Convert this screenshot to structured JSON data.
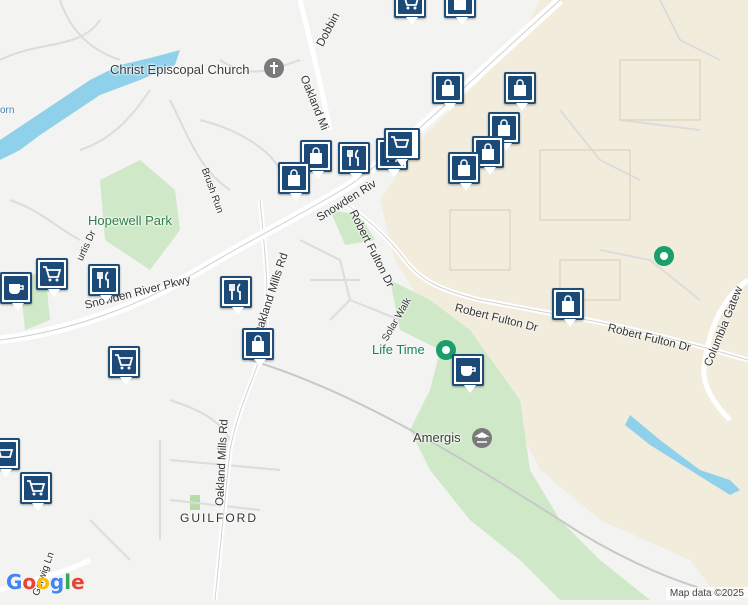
{
  "map": {
    "roads": [
      "Snowden River Pkwy",
      "Robert Fulton Dr",
      "Robert Fulton Dr",
      "Robert Fulton Dr",
      "Oakland Mills Rd",
      "Oakland Mills Rd",
      "Oakland Mi",
      "Snowden Riv",
      "Columbia Gatew",
      "Solar Walk",
      "Brush Run",
      "Dobbin",
      "Gerwig Ln",
      "urtis Dr"
    ],
    "pois": {
      "church": "Christ Episcopal Church",
      "park": "Hopewell Park",
      "gym": "Life Time",
      "office": "Amergis"
    },
    "place": "GUILFORD",
    "water_label": "orn",
    "colors": {
      "background": "#f3f3f1",
      "water": "#8fd1ea",
      "park": "#cfe9c8",
      "commercial": "#f2ecdd",
      "road": "#ffffff",
      "marker": "#1b4a78",
      "poi_green": "#1a9e6a"
    },
    "logo": "Google",
    "attribution": "Map data ©2025"
  }
}
